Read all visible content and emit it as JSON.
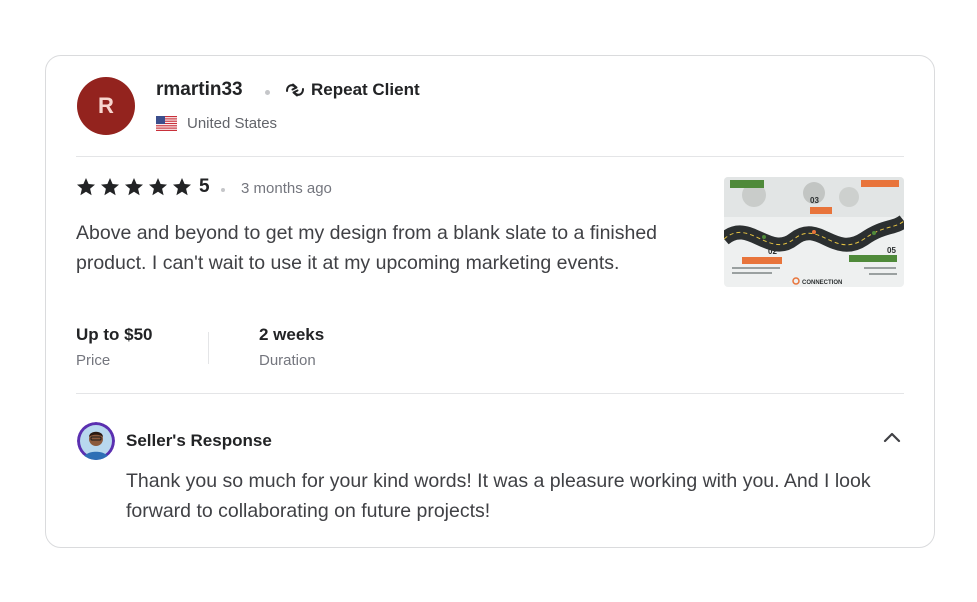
{
  "review": {
    "avatar_initial": "R",
    "username": "rmartin33",
    "badge_label": "Repeat Client",
    "country": "United States",
    "rating": "5",
    "time_ago": "3 months ago",
    "text": "Above and beyond to get my design from a blank slate to a finished product. I can't wait to use it at my upcoming marketing events.",
    "price": {
      "value": "Up to $50",
      "label": "Price"
    },
    "duration": {
      "value": "2 weeks",
      "label": "Duration"
    },
    "thumbnail": {
      "labels": [
        "03",
        "02",
        "05"
      ],
      "brand": "CONNECTION"
    }
  },
  "seller_response": {
    "title": "Seller's Response",
    "text": "Thank you so much for your kind words! It was a pleasure working with you. And I look forward to collaborating on future projects!"
  },
  "colors": {
    "avatar_bg": "#93231e",
    "star": "#222325",
    "accent_orange": "#e8743b",
    "accent_green": "#4f8a3a"
  },
  "icons": {
    "badge": "repeat-icon",
    "flag": "us-flag-icon",
    "star": "star-icon",
    "collapse": "chevron-up-icon"
  }
}
